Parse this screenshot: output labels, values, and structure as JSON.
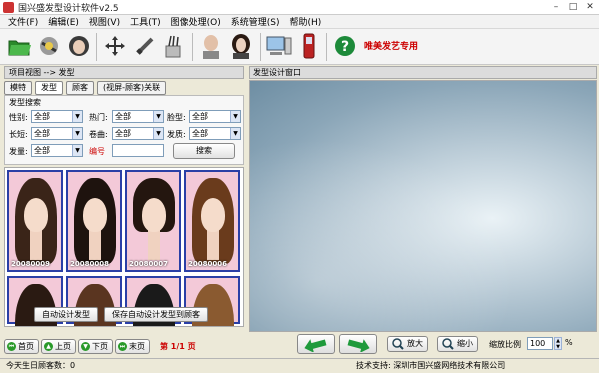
{
  "window": {
    "title": "国兴盛发型设计软件v2.5"
  },
  "menu": [
    "文件(F)",
    "编辑(E)",
    "视图(V)",
    "工具(T)",
    "图像处理(O)",
    "系统管理(S)",
    "帮助(H)"
  ],
  "toolbar": {
    "label": "唯美发艺专用"
  },
  "left": {
    "header": "项目视图 --> 发型",
    "tabs": [
      "模特",
      "发型",
      "顾客",
      "(视屏-顾客)关联"
    ],
    "search": {
      "legend": "发型搜索",
      "gender": {
        "label": "性别:",
        "value": "全部"
      },
      "hot": {
        "label": "热门:",
        "value": "全部"
      },
      "face": {
        "label": "脸型:",
        "value": "全部"
      },
      "length": {
        "label": "长短:",
        "value": "全部"
      },
      "curl": {
        "label": "卷曲:",
        "value": "全部"
      },
      "quality": {
        "label": "发质:",
        "value": "全部"
      },
      "volume": {
        "label": "发量:",
        "value": "全部"
      },
      "code_label": "编号",
      "code_value": "",
      "search_btn": "搜索"
    },
    "cards": [
      {
        "code": "20080009"
      },
      {
        "code": "20080008"
      },
      {
        "code": "20080007"
      },
      {
        "code": "20080006"
      },
      {
        "code": ""
      },
      {
        "code": ""
      },
      {
        "code": ""
      },
      {
        "code": ""
      }
    ],
    "auto_design": "自动设计发型",
    "save_auto": "保存自动设计发型到顾客",
    "pager": {
      "first": "首页",
      "prev": "上页",
      "next": "下页",
      "last": "末页",
      "info": "第 1/1 页"
    }
  },
  "right": {
    "header": "发型设计窗口",
    "zoom_in": "放大",
    "zoom_out": "缩小",
    "zoom_label": "缩放比例",
    "zoom_value": "100",
    "zoom_unit": "%"
  },
  "status": {
    "left": "今天生日顾客数：0",
    "right": "技术支持: 深圳市国兴盛网络技术有限公司"
  }
}
